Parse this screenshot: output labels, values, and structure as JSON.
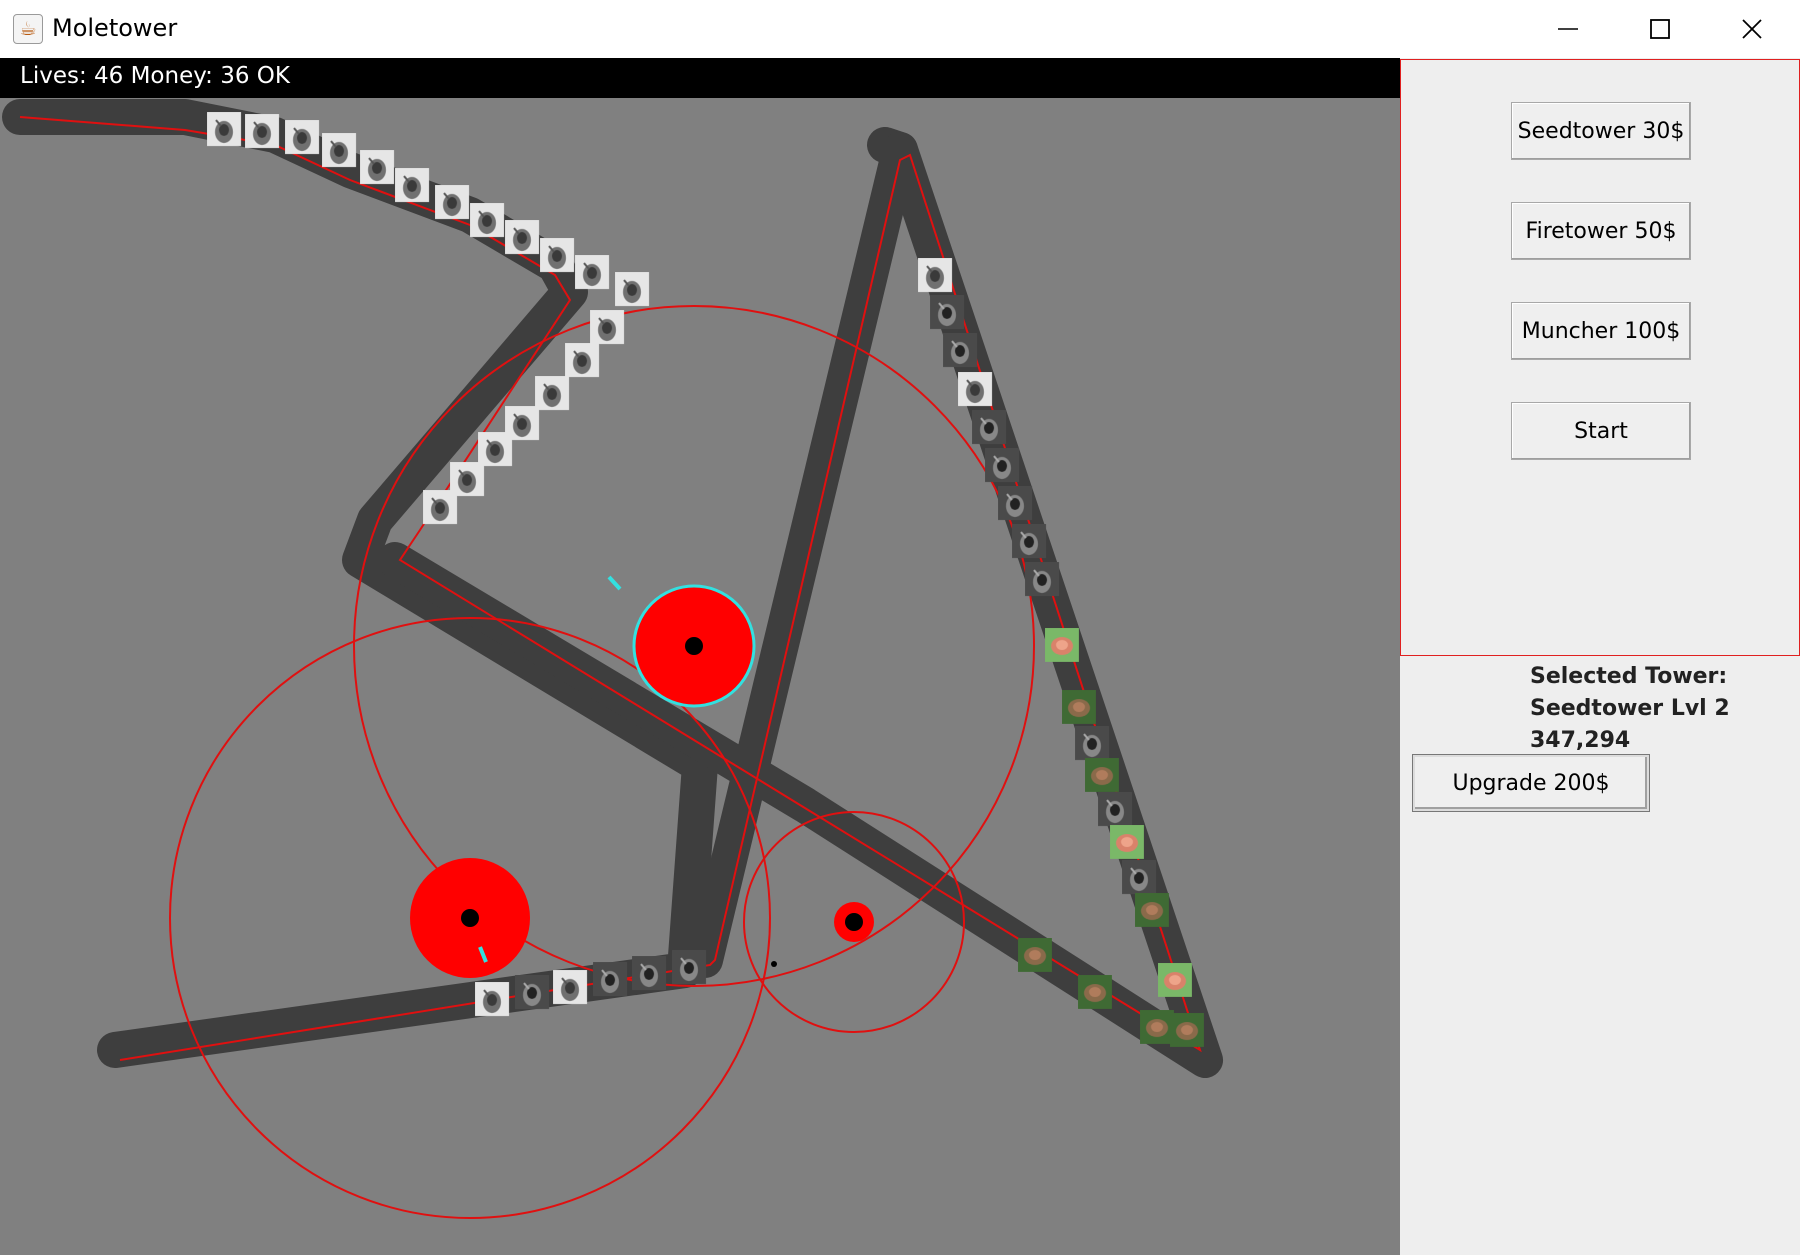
{
  "window": {
    "title": "Moletower",
    "icon": "java-cup-icon",
    "controls": [
      "minimize-icon",
      "maximize-icon",
      "close-icon"
    ]
  },
  "status": {
    "text": "Lives: 46 Money: 36 OK",
    "lives": 46,
    "money": 36,
    "state": "OK"
  },
  "shop": {
    "buttons": {
      "seedtower": "Seedtower 30$",
      "firetower": "Firetower 50$",
      "muncher": "Muncher 100$",
      "start": "Start"
    }
  },
  "selection": {
    "heading": "Selected Tower:",
    "name": "Seedtower Lvl 2",
    "position": "347,294",
    "upgrade_button": "Upgrade 200$"
  },
  "colors": {
    "background": "#808080",
    "path": "#3e3e3e",
    "route_line": "#e01010",
    "tower": "#ff0000",
    "selected_ring": "#33e0e0",
    "status_bar": "#000000",
    "panel": "#eeeeee"
  },
  "enemy_types": [
    "grey-mole",
    "dark-mole",
    "green-frog",
    "pink-frog"
  ]
}
